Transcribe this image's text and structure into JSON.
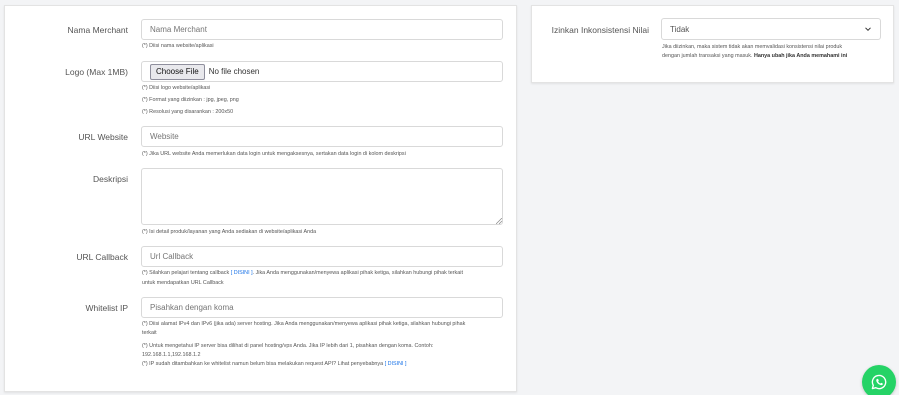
{
  "form": {
    "merchant_name": {
      "label": "Nama Merchant",
      "placeholder": "Nama Merchant",
      "hint": "(*) Diisi nama website/aplikasi"
    },
    "logo": {
      "label": "Logo (Max 1MB)",
      "button_label": "Choose File",
      "file_status": "No file chosen",
      "hints": [
        "(*) Diisi logo website/aplikasi",
        "(*) Format yang diizinkan : jpg, jpeg, png",
        "(*) Resolusi yang disarankan : 200x50"
      ]
    },
    "url_website": {
      "label": "URL Website",
      "placeholder": "Website",
      "hint": "(*) Jika URL website Anda memerlukan data login untuk mengaksesnya, sertakan data login di kolom deskripsi"
    },
    "description": {
      "label": "Deskripsi",
      "hint": "(*) Isi detail produk/layanan yang Anda sediakan di website/aplikasi Anda"
    },
    "url_callback": {
      "label": "URL Callback",
      "placeholder": "Url Callback",
      "hint_prefix": "(*) Silahkan pelajari tentang callback",
      "hint_link": "[ DISINI ]",
      "hint_suffix": ". Jika Anda menggunakan/menyewa aplikasi pihak ketiga, silahkan hubungi pihak terkait",
      "hint_line2": "untuk mendapatkan URL Callback"
    },
    "whitelist_ip": {
      "label": "Whitelist IP",
      "placeholder": "Pisahkan dengan koma",
      "hint1_line1": "(*) Diisi alamat IPv4 dan IPv6 (jika ada) server hosting. Jika Anda menggunakan/menyewa aplikasi pihak ketiga, silahkan hubungi pihak",
      "hint1_line2": "terkait",
      "hint2_line1": "(*) Untuk mengetahui IP server bisa dilihat di panel hosting/vps Anda. Jika IP lebih dari 1, pisahkan dengan koma. Contoh:",
      "hint2_line2": "192.168.1.1,192.168.1.2",
      "hint3_prefix": "(*) IP sudah ditambahkan ke whitelist namun belum bisa melakukan request API? Lihat penyebabnya",
      "hint3_link": "[ DISINI ]"
    }
  },
  "settings": {
    "inconsistency": {
      "label": "Izinkan Inkonsistensi Nilai",
      "selected": "Tidak",
      "hint_line1": "Jika diizinkan, maka sistem tidak akan memvalidasi konsistensi nilai produk",
      "hint_line2_prefix": "dengan jumlah transaksi yang masuk.",
      "hint_line2_strong": "Hanya ubah jika Anda memahami ini"
    }
  },
  "colors": {
    "link": "#1a73e8",
    "whatsapp": "#25d366"
  },
  "icons": {
    "select_chevron": "chevron-down-icon",
    "chat": "whatsapp-icon"
  }
}
